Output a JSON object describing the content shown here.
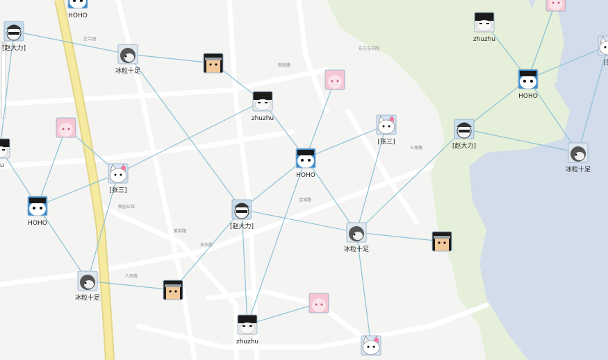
{
  "colors": {
    "land": "#f4f4f2",
    "park": "#e6efd9",
    "water": "#d2dcea",
    "road_main": "#f5eaa0",
    "road_main_edge": "#e2d68c",
    "road_minor": "#ffffff",
    "link": "#8cc2d6"
  },
  "nodes": [
    {
      "id": "n1",
      "label": "HOHO",
      "avatar": "hoho"
    },
    {
      "id": "n2",
      "label": "[赵大力]",
      "avatar": "zhao"
    },
    {
      "id": "n3",
      "label": "冰粒十足",
      "avatar": "bingli"
    },
    {
      "id": "n4",
      "label": "",
      "avatar": "ninja"
    },
    {
      "id": "n5",
      "label": "",
      "avatar": "pink"
    },
    {
      "id": "n6",
      "label": "zhuzhu",
      "avatar": "zhuzhu"
    },
    {
      "id": "n7",
      "label": "",
      "avatar": "pink"
    },
    {
      "id": "n8",
      "label": "[张三]",
      "avatar": "cat"
    },
    {
      "id": "n9",
      "label": "HOHO",
      "avatar": "hoho"
    },
    {
      "id": "n10",
      "label": "[张三]",
      "avatar": "cat"
    },
    {
      "id": "n11",
      "label": "[赵大力]",
      "avatar": "zhao"
    },
    {
      "id": "n12",
      "label": "zhuzhu",
      "avatar": "zhuzhu"
    },
    {
      "id": "n13",
      "label": "HOHO",
      "avatar": "hoho"
    },
    {
      "id": "n14",
      "label": "",
      "avatar": "pink"
    },
    {
      "id": "n15",
      "label": "[张",
      "avatar": "cat"
    },
    {
      "id": "n16",
      "label": "冰粒十足",
      "avatar": "bingli"
    },
    {
      "id": "n17",
      "label": "HOHO",
      "avatar": "hoho"
    },
    {
      "id": "n18",
      "label": "[赵大力]",
      "avatar": "zhao"
    },
    {
      "id": "n19",
      "label": "冰粒十足",
      "avatar": "bingli"
    },
    {
      "id": "n20",
      "label": "",
      "avatar": "ninja"
    },
    {
      "id": "n21",
      "label": "冰粒十足",
      "avatar": "bingli"
    },
    {
      "id": "n22",
      "label": "",
      "avatar": "ninja"
    },
    {
      "id": "n23",
      "label": "zhuzhu",
      "avatar": "zhuzhu"
    },
    {
      "id": "n24",
      "label": "",
      "avatar": "pink"
    },
    {
      "id": "n25",
      "label": "",
      "avatar": "cat"
    },
    {
      "id": "n26",
      "label": "hu",
      "avatar": "zhuzhu"
    }
  ],
  "links": [
    [
      "n2",
      "n3"
    ],
    [
      "n3",
      "n4"
    ],
    [
      "n4",
      "n6"
    ],
    [
      "n3",
      "n18"
    ],
    [
      "n6",
      "n9"
    ],
    [
      "n6",
      "n10"
    ],
    [
      "n5",
      "n9"
    ],
    [
      "n7",
      "n10"
    ],
    [
      "n8",
      "n9"
    ],
    [
      "n8",
      "n19"
    ],
    [
      "n9",
      "n18"
    ],
    [
      "n9",
      "n19"
    ],
    [
      "n9",
      "n23"
    ],
    [
      "n10",
      "n17"
    ],
    [
      "n11",
      "n19"
    ],
    [
      "n11",
      "n13"
    ],
    [
      "n12",
      "n13"
    ],
    [
      "n13",
      "n14"
    ],
    [
      "n13",
      "n16"
    ],
    [
      "n13",
      "n15"
    ],
    [
      "n15",
      "n16"
    ],
    [
      "n18",
      "n19"
    ],
    [
      "n18",
      "n23"
    ],
    [
      "n18",
      "n22"
    ],
    [
      "n19",
      "n20"
    ],
    [
      "n19",
      "n25"
    ],
    [
      "n17",
      "n21"
    ],
    [
      "n10",
      "n21"
    ],
    [
      "n21",
      "n22"
    ],
    [
      "n24",
      "n23"
    ],
    [
      "n7",
      "n17"
    ],
    [
      "n14",
      "n13"
    ],
    [
      "n16",
      "n11"
    ],
    [
      "n2",
      "n26"
    ],
    [
      "n26",
      "n17"
    ]
  ],
  "map_labels": [
    "芷兰园",
    "东方东书院",
    "新园路",
    "金城路",
    "紫荆路",
    "东水路",
    "三角路",
    "新园公馆",
    "人民路"
  ]
}
